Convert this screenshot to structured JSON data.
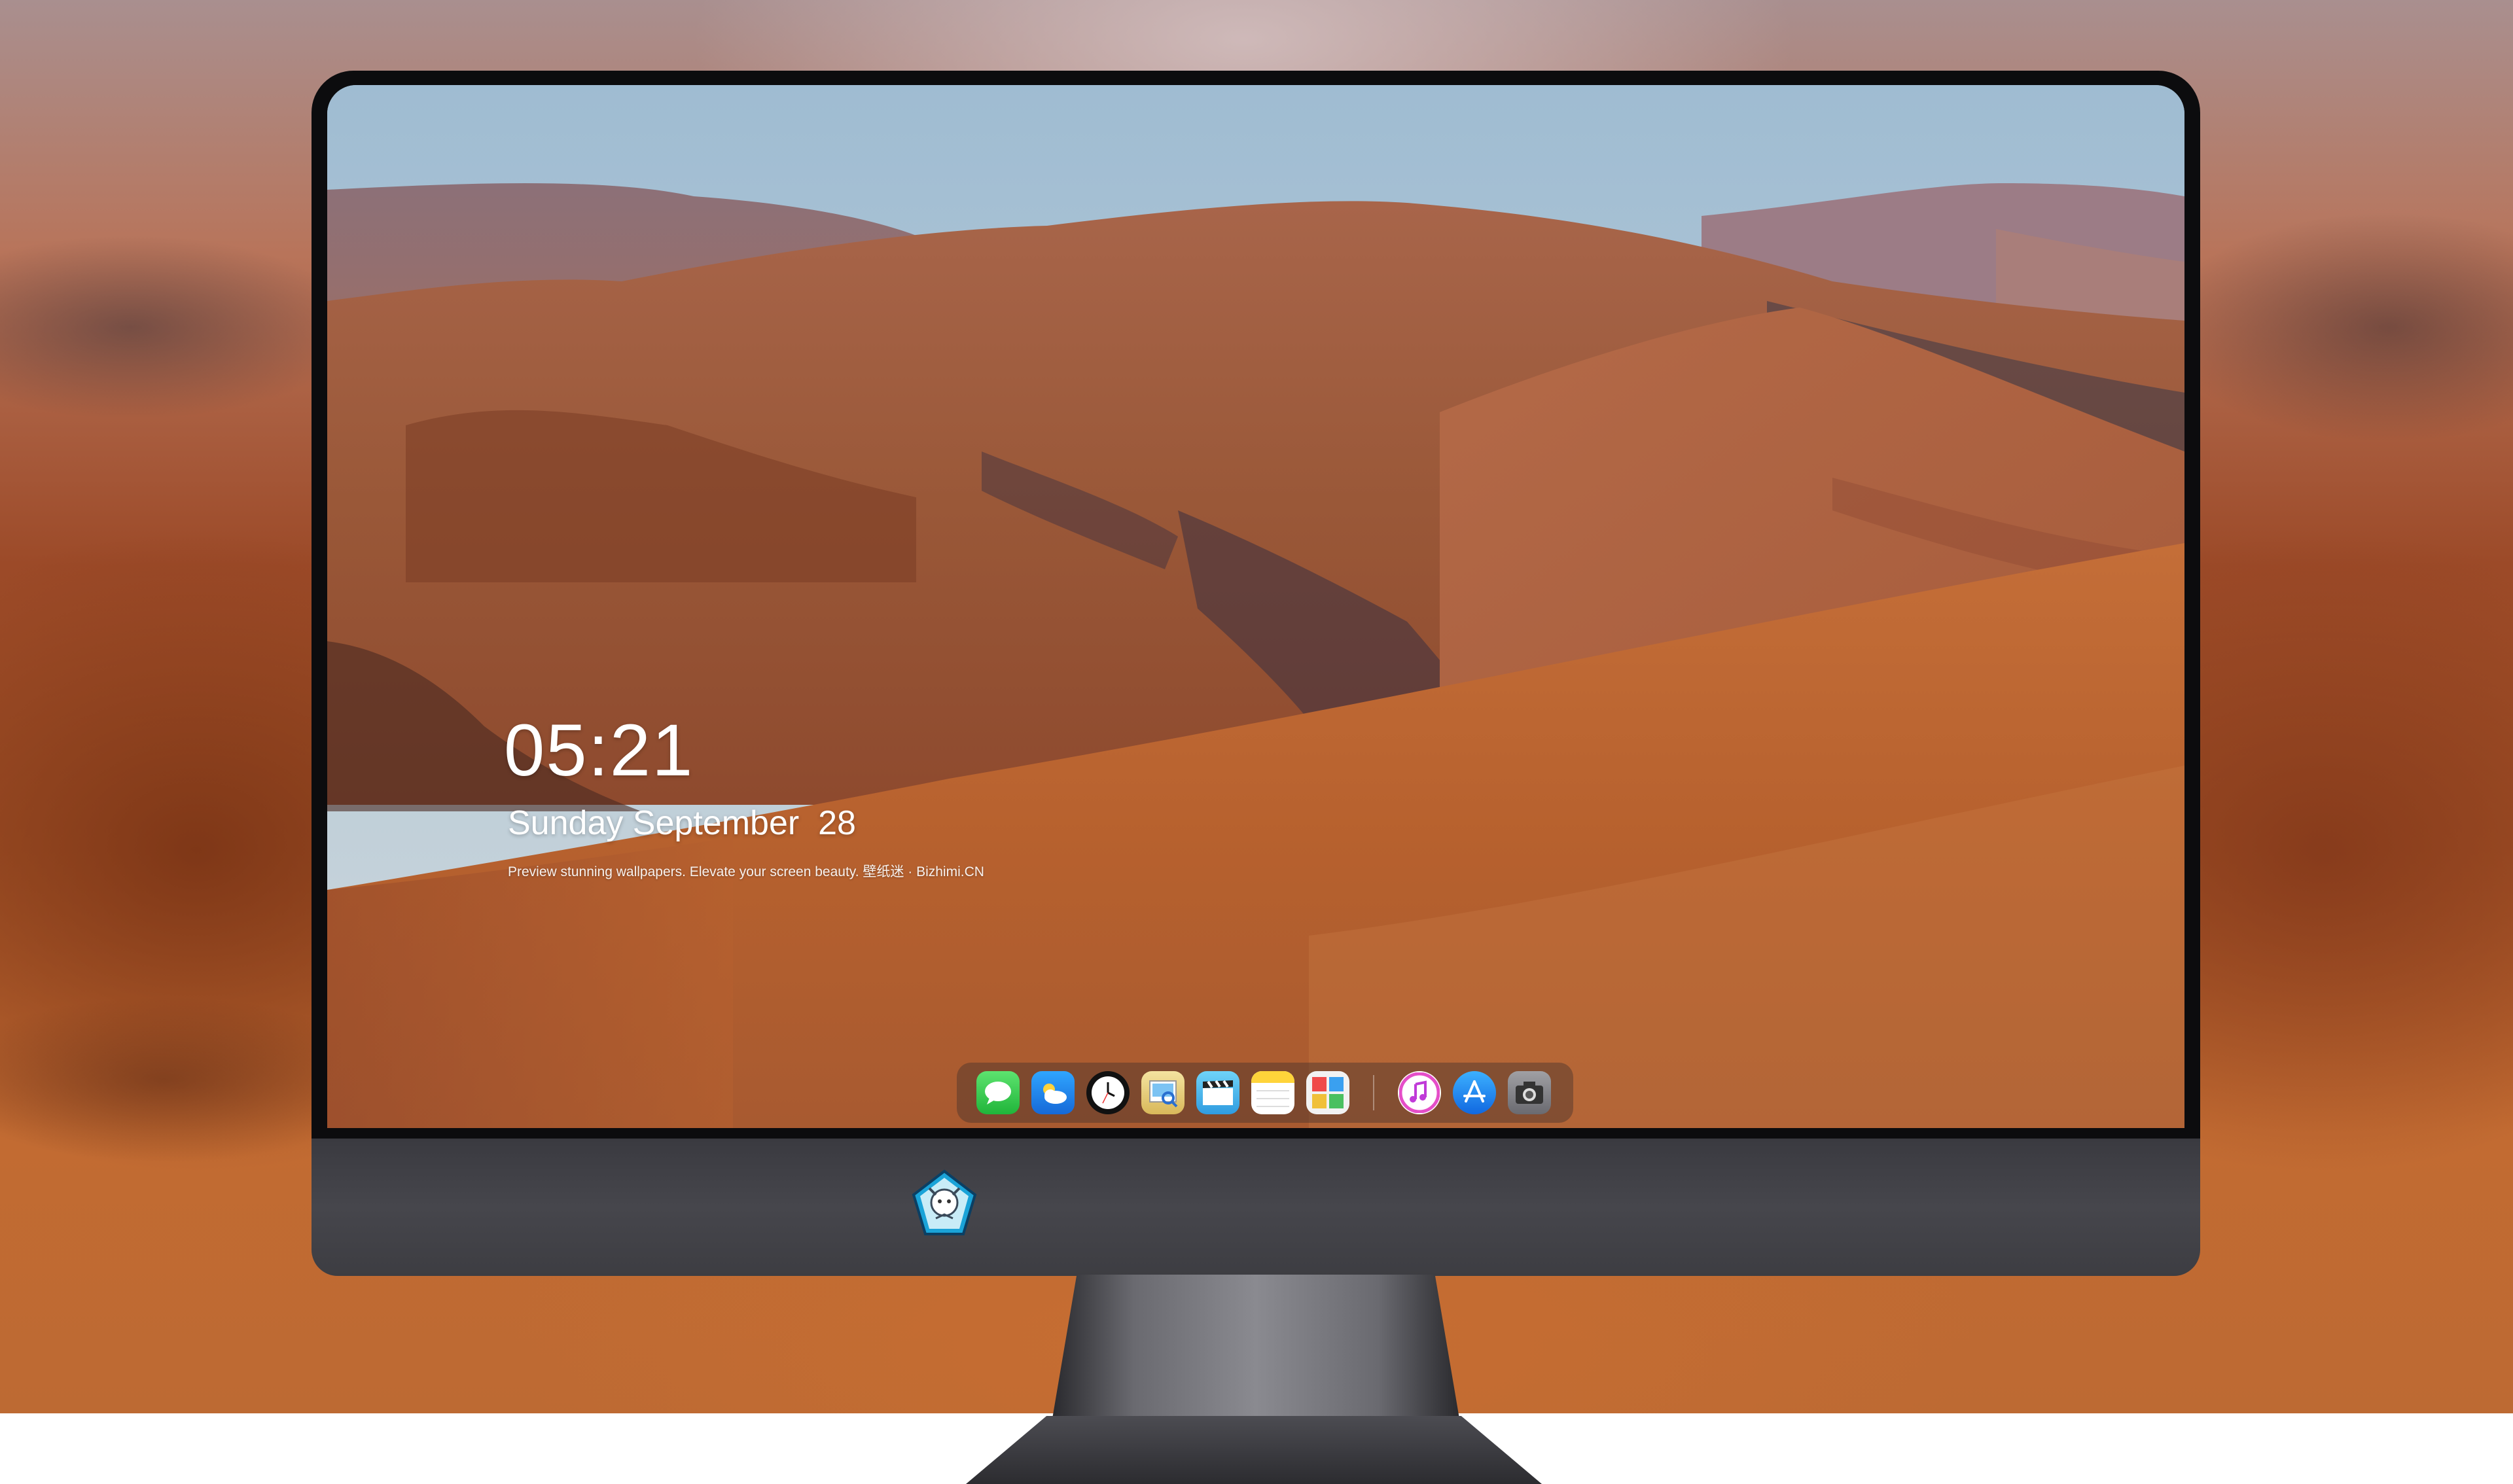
{
  "lock_screen": {
    "time": "05:21",
    "date": "Sunday September  28",
    "tagline": "Preview stunning wallpapers. Elevate your screen beauty. 壁纸迷 · Bizhimi.CN"
  },
  "dock": {
    "apps": [
      {
        "name": "messages-icon",
        "color": "#2fc84a"
      },
      {
        "name": "weather-icon",
        "color": "#1e8ff0"
      },
      {
        "name": "clock-icon",
        "color": "#111111"
      },
      {
        "name": "preview-icon",
        "color": "#e8d07a"
      },
      {
        "name": "clips-icon",
        "color": "#45b6e8"
      },
      {
        "name": "notes-icon",
        "color": "#ffd84a"
      },
      {
        "name": "photo-booth-icon",
        "color": "#f2f2f2"
      },
      {
        "name": "itunes-icon",
        "color": "#e54ec8"
      },
      {
        "name": "app-store-icon",
        "color": "#1a8cf5"
      },
      {
        "name": "camera-icon",
        "color": "#8a8a8a"
      }
    ]
  },
  "colors": {
    "sky": "#b9cdd9",
    "desert": "#b5603a",
    "bezel": "#0c0c0e",
    "chin": "#424248"
  }
}
